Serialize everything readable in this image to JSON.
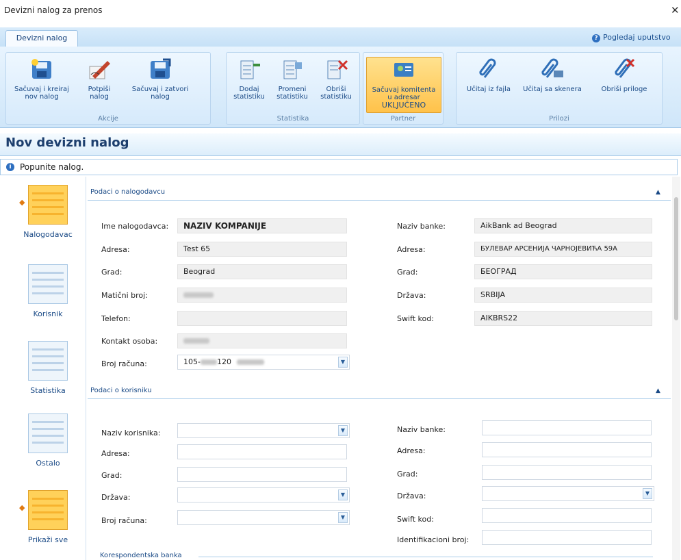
{
  "window": {
    "title": "Devizni nalog za prenos"
  },
  "ribbon": {
    "tab": "Devizni nalog",
    "help": "Pogledaj uputstvo",
    "groups": {
      "akcije": "Akcije",
      "statistika": "Statistika",
      "partner": "Partner",
      "prilozi": "Prilozi"
    },
    "buttons": {
      "save_new_1": "Sačuvaj i kreiraj",
      "save_new_2": "nov nalog",
      "sign_1": "Potpiši",
      "sign_2": "nalog",
      "save_close_1": "Sačuvaj i zatvori",
      "save_close_2": "nalog",
      "add_stat_1": "Dodaj",
      "add_stat_2": "statistiku",
      "change_stat_1": "Promeni",
      "change_stat_2": "statistiku",
      "delete_stat_1": "Obriši",
      "delete_stat_2": "statistiku",
      "save_client_1": "Sačuvaj komitenta",
      "save_client_2": "u adresar",
      "save_client_3": "UKLJUČENO",
      "load_file": "Učitaj iz fajla",
      "load_scanner": "Učitaj sa skenera",
      "delete_attach": "Obriši priloge"
    }
  },
  "page": {
    "title": "Nov devizni nalog",
    "info": "Popunite nalog."
  },
  "nav": [
    {
      "label": "Nalogodavac"
    },
    {
      "label": "Korisnik"
    },
    {
      "label": "Statistika"
    },
    {
      "label": "Ostalo"
    },
    {
      "label": "Prikaži sve"
    }
  ],
  "sender": {
    "header": "Podaci o nalogodavcu",
    "labels": {
      "name": "Ime nalogodavca:",
      "address": "Adresa:",
      "city": "Grad:",
      "id_number": "Matični broj:",
      "phone": "Telefon:",
      "contact": "Kontakt osoba:",
      "account": "Broj računa:",
      "bank_name": "Naziv banke:",
      "bank_address": "Adresa:",
      "bank_city": "Grad:",
      "country": "Država:",
      "swift": "Swift kod:"
    },
    "values": {
      "name": "NAZIV KOMPANIJE",
      "address": "Test 65",
      "city": "Beograd",
      "phone": "",
      "account_prefix": "105-",
      "account_mid": "120",
      "bank_name": "AikBank ad Beograd",
      "bank_address": "БУЛЕВАР АРСЕНИЈА ЧАРНОЈЕВИЋА 59А",
      "bank_city": "БЕОГРАД",
      "country": "SRBIJA",
      "swift": "AIKBRS22"
    }
  },
  "recipient": {
    "header": "Podaci o korisniku",
    "labels": {
      "name": "Naziv korisnika:",
      "address": "Adresa:",
      "city": "Grad:",
      "country": "Država:",
      "account": "Broj računa:",
      "bank_name": "Naziv banke:",
      "bank_address": "Adresa:",
      "bank_city": "Grad:",
      "bank_country": "Država:",
      "swift": "Swift kod:",
      "id": "Identifikacioni broj:"
    }
  },
  "correspondent": {
    "header": "Korespondentska banka"
  },
  "colors": {
    "accent": "#1d3f6e",
    "highlight": "#ffc24a",
    "ribbon": "#cfe6f9"
  }
}
